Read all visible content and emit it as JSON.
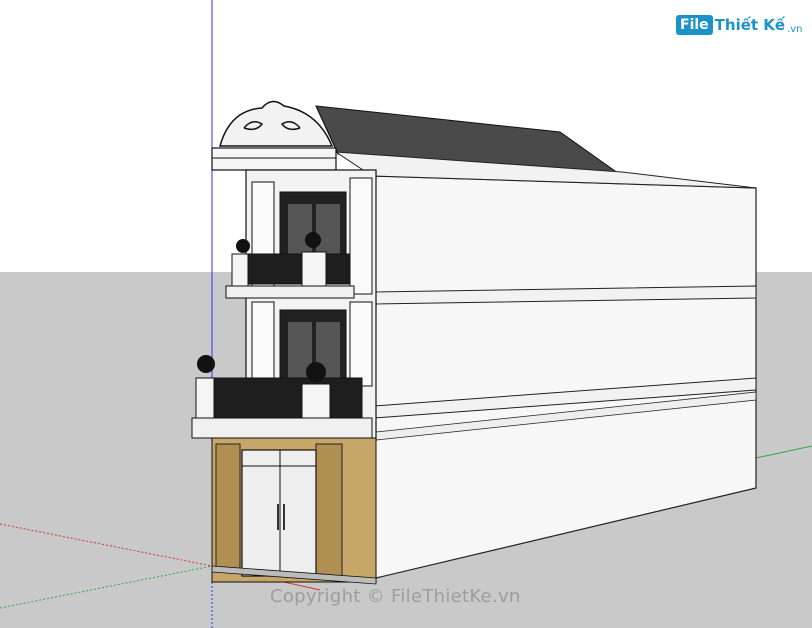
{
  "logo": {
    "file": "File",
    "name": "Thiết Kế",
    "tld": ".vn"
  },
  "watermark": "Copyright © FileThietKe.vn",
  "colors": {
    "sky": "#ffffff",
    "ground": "#c9c9c9",
    "wall": "#f7f7f7",
    "roof": "#4a4a4a",
    "stone": "#c7a66a",
    "railing": "#1e1e1e",
    "axis_blue": "#3030ff",
    "axis_red": "#d23a3a",
    "axis_green": "#2fa84a",
    "brand": "#1b93c9"
  }
}
